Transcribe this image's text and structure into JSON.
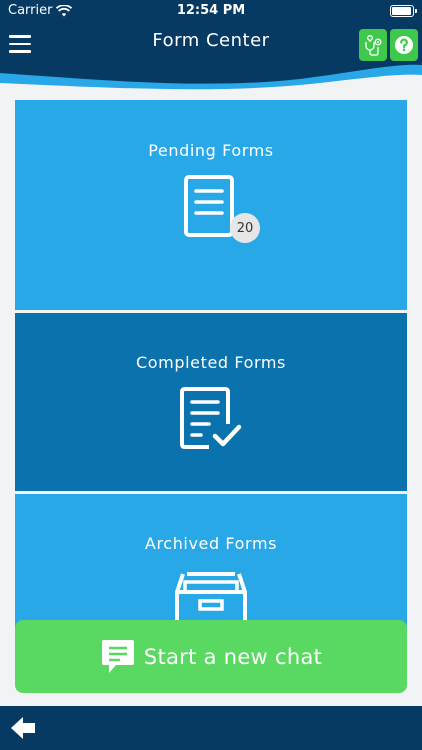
{
  "status_bar": {
    "carrier": "Carrier",
    "time": "12:54 PM",
    "battery_level": 0.95
  },
  "header": {
    "title": "Form Center",
    "menu_icon": "hamburger-icon",
    "right_icons": [
      "doctor-location-icon",
      "help-icon"
    ]
  },
  "tiles": [
    {
      "label": "Pending Forms",
      "icon": "document-icon",
      "badge": "20"
    },
    {
      "label": "Completed Forms",
      "icon": "document-check-icon"
    },
    {
      "label": "Archived Forms",
      "icon": "archive-box-icon"
    }
  ],
  "chat": {
    "label": "Start a new chat",
    "icon": "chat-bubble-icon"
  },
  "footer": {
    "back_icon": "back-arrow-icon"
  },
  "colors": {
    "header": "#063a63",
    "tile_light": "#29a8e8",
    "tile_dark": "#0a72ad",
    "accent_green": "#59d862",
    "background": "#f2f3f5"
  }
}
